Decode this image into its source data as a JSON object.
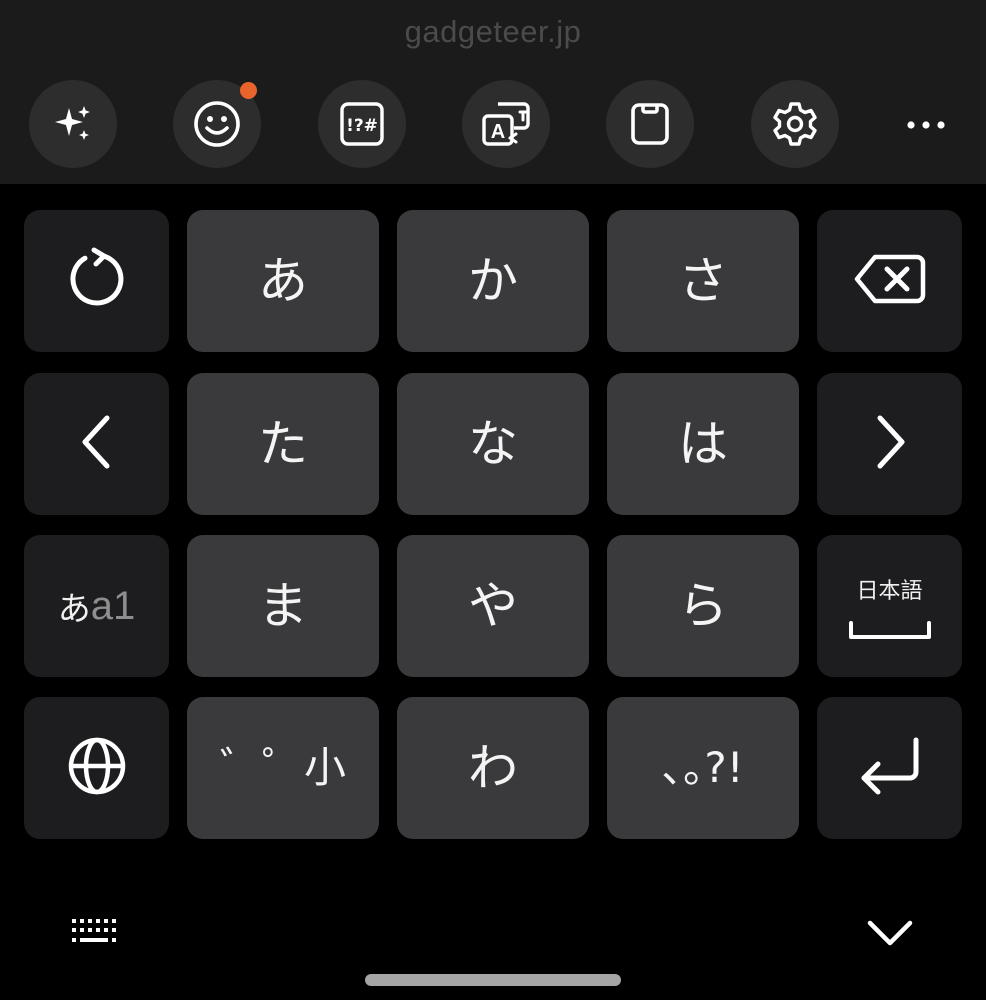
{
  "watermark": "gadgeteer.jp",
  "toolbar": {
    "buttons": [
      {
        "name": "ai-tools",
        "icon": "sparkles-icon"
      },
      {
        "name": "emoji",
        "icon": "smiley-icon",
        "has_notification": true
      },
      {
        "name": "symbols",
        "icon": "symbols-icon",
        "icon_text": "!?#"
      },
      {
        "name": "translate",
        "icon": "translate-icon",
        "icon_text": "A"
      },
      {
        "name": "clipboard",
        "icon": "clipboard-icon"
      },
      {
        "name": "settings",
        "icon": "gear-icon"
      }
    ],
    "more": {
      "icon": "more-horizontal-icon"
    }
  },
  "keyboard": {
    "side_left": [
      {
        "name": "undo",
        "icon": "undo-icon"
      },
      {
        "name": "cursor-left",
        "icon": "chevron-left-icon"
      },
      {
        "name": "mode-switch",
        "label_primary": "あ",
        "label_secondary": "a1"
      },
      {
        "name": "language",
        "icon": "globe-icon"
      }
    ],
    "main_keys": [
      [
        "あ",
        "か",
        "さ"
      ],
      [
        "た",
        "な",
        "は"
      ],
      [
        "ま",
        "や",
        "ら"
      ],
      [
        "゛゜小",
        "わ",
        "､｡?!"
      ]
    ],
    "side_right": [
      {
        "name": "backspace",
        "icon": "backspace-icon"
      },
      {
        "name": "cursor-right",
        "icon": "chevron-right-icon"
      },
      {
        "name": "space",
        "label": "日本語",
        "icon": "space-bar-icon"
      },
      {
        "name": "enter",
        "icon": "enter-arrow-icon"
      }
    ]
  },
  "bottom_bar": {
    "left_icon": "keyboard-icon",
    "right_icon": "chevron-down-icon"
  },
  "colors": {
    "toolbar_bg": "#1b1b1b",
    "keyboard_bg": "#000000",
    "main_key": "#3a3a3c",
    "side_key": "#1d1d1f",
    "notification": "#e8642c",
    "watermark": "#4b4b4b"
  }
}
